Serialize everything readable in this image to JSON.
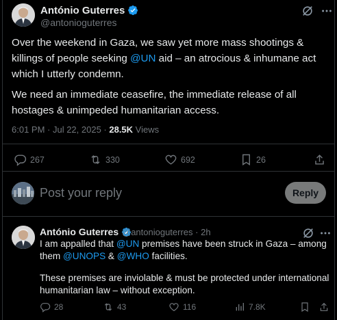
{
  "main_tweet": {
    "author_name": "António Guterres",
    "handle": "@antonioguterres",
    "para1_before": "Over the weekend in Gaza, we saw yet more mass shootings & killings of people seeking ",
    "para1_mention": "@UN",
    "para1_after": " aid – an atrocious & inhumane act which I utterly condemn.",
    "para2": "We need an immediate ceasefire, the immediate release of all hostages & unimpeded humanitarian access.",
    "time": "6:01 PM · Jul 22, 2025 · ",
    "views_count": "28.5K",
    "views_label": " Views",
    "replies": "267",
    "reposts": "330",
    "likes": "692",
    "bookmarks": "26"
  },
  "composer": {
    "placeholder": "Post your reply",
    "reply_label": "Reply"
  },
  "second_tweet": {
    "author_name": "António Guterres",
    "handle_time": "@antonioguterres · 2h",
    "line1_before": "I am appalled that ",
    "line1_mention": "@UN",
    "line1_after": " premises have been struck in Gaza – among them ",
    "mention2": "@UNOPS",
    "amp": " & ",
    "mention3": "@WHO",
    "line2_after": " facilities.",
    "para2": "These premises are inviolable & must be protected under international humanitarian law – without exception.",
    "replies": "28",
    "reposts": "43",
    "likes": "116",
    "views": "7.8K"
  },
  "colors": {
    "background": "#000000",
    "text": "#e7e9ea",
    "secondary": "#71767b",
    "link": "#1d9bf0",
    "verified": "#1d9bf0"
  },
  "icons": [
    "verified-badge-icon",
    "grok-icon",
    "more-icon",
    "reply-icon",
    "repost-icon",
    "like-icon",
    "bookmark-icon",
    "share-icon",
    "views-icon"
  ]
}
